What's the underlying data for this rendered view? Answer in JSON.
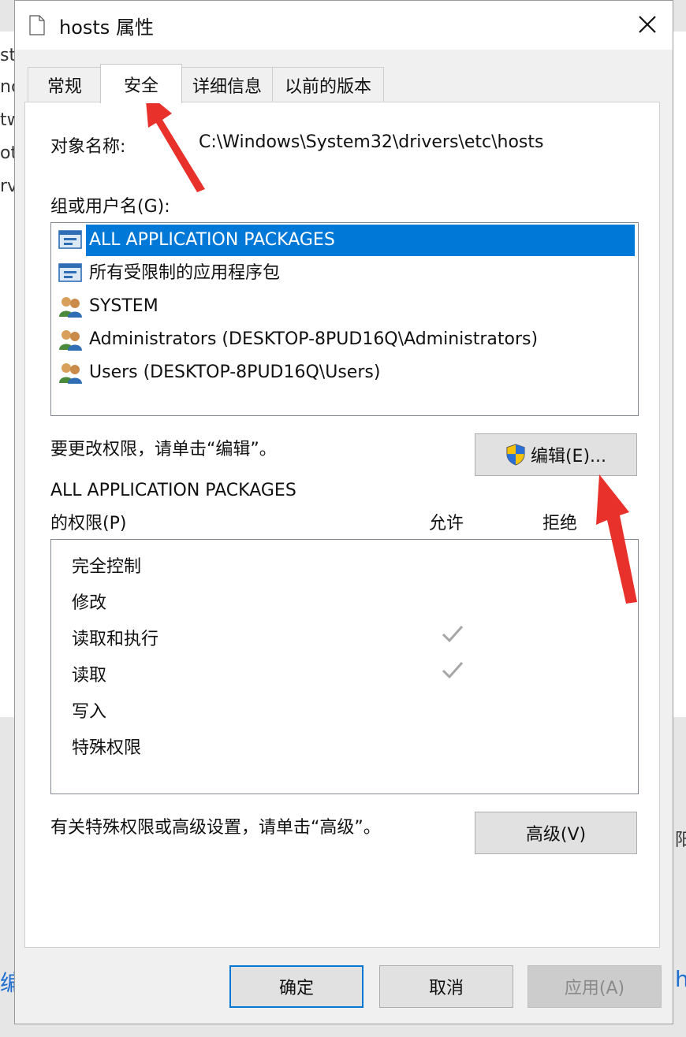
{
  "background": {
    "left_fragments": [
      "st",
      "nc",
      "tw",
      "ot",
      "rv"
    ],
    "right_fragment": "阳",
    "bottom_left_fragment": "编",
    "bottom_right_fragment": "h"
  },
  "window": {
    "title": "hosts 属性",
    "close_glyph": "✕"
  },
  "tabs": [
    {
      "label": "常规",
      "active": false
    },
    {
      "label": "安全",
      "active": true
    },
    {
      "label": "详细信息",
      "active": false
    },
    {
      "label": "以前的版本",
      "active": false
    }
  ],
  "security": {
    "object_name_label": "对象名称:",
    "object_name_value": "C:\\Windows\\System32\\drivers\\etc\\hosts",
    "groups_label": "组或用户名(G):",
    "groups": [
      {
        "name": "ALL APPLICATION PACKAGES",
        "icon": "app-package-icon",
        "selected": true
      },
      {
        "name": "所有受限制的应用程序包",
        "icon": "app-package-icon",
        "selected": false
      },
      {
        "name": "SYSTEM",
        "icon": "users-icon",
        "selected": false
      },
      {
        "name": "Administrators (DESKTOP-8PUD16Q\\Administrators)",
        "icon": "users-icon",
        "selected": false
      },
      {
        "name": "Users (DESKTOP-8PUD16Q\\Users)",
        "icon": "users-icon",
        "selected": false
      }
    ],
    "change_hint": "要更改权限，请单击“编辑”。",
    "edit_button": "编辑(E)...",
    "perm_title_line1": "ALL APPLICATION PACKAGES",
    "perm_title_line2": "的权限(P)",
    "allow_header": "允许",
    "deny_header": "拒绝",
    "permissions": [
      {
        "name": "完全控制",
        "allow": false,
        "deny": false
      },
      {
        "name": "修改",
        "allow": false,
        "deny": false
      },
      {
        "name": "读取和执行",
        "allow": true,
        "deny": false
      },
      {
        "name": "读取",
        "allow": true,
        "deny": false
      },
      {
        "name": "写入",
        "allow": false,
        "deny": false
      },
      {
        "name": "特殊权限",
        "allow": false,
        "deny": false
      }
    ],
    "advanced_hint": "有关特殊权限或高级设置，请单击“高级”。",
    "advanced_button": "高级(V)"
  },
  "footer": {
    "ok": "确定",
    "cancel": "取消",
    "apply": "应用(A)"
  },
  "colors": {
    "selection": "#0078d7",
    "annotation_arrow": "#e8312a"
  }
}
